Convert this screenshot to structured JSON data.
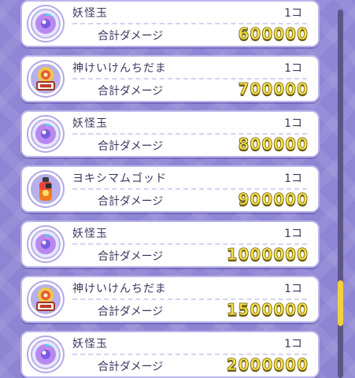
{
  "items": [
    {
      "icon": "yokai-orb-icon",
      "name": "妖怪玉",
      "count": "1コ",
      "damage_label": "合計ダメージ",
      "damage": "600000"
    },
    {
      "icon": "god-bell-icon",
      "name": "神けいけんちだま",
      "count": "1コ",
      "damage_label": "合計ダメージ",
      "damage": "700000"
    },
    {
      "icon": "yokai-orb-icon",
      "name": "妖怪玉",
      "count": "1コ",
      "damage_label": "合計ダメージ",
      "damage": "800000"
    },
    {
      "icon": "yokishima-god-bottle-icon",
      "name": "ヨキシマムゴッド",
      "count": "1コ",
      "damage_label": "合計ダメージ",
      "damage": "900000"
    },
    {
      "icon": "yokai-orb-icon",
      "name": "妖怪玉",
      "count": "1コ",
      "damage_label": "合計ダメージ",
      "damage": "1000000"
    },
    {
      "icon": "god-bell-icon",
      "name": "神けいけんちだま",
      "count": "1コ",
      "damage_label": "合計ダメージ",
      "damage": "1500000"
    },
    {
      "icon": "yokai-orb-icon",
      "name": "妖怪玉",
      "count": "1コ",
      "damage_label": "合計ダメージ",
      "damage": "2000000"
    }
  ],
  "scroll_position": 0.84,
  "colors": {
    "background": "#8f86d6",
    "damage_text": "#f6e04b",
    "scroll_thumb": "#f2d13a"
  }
}
